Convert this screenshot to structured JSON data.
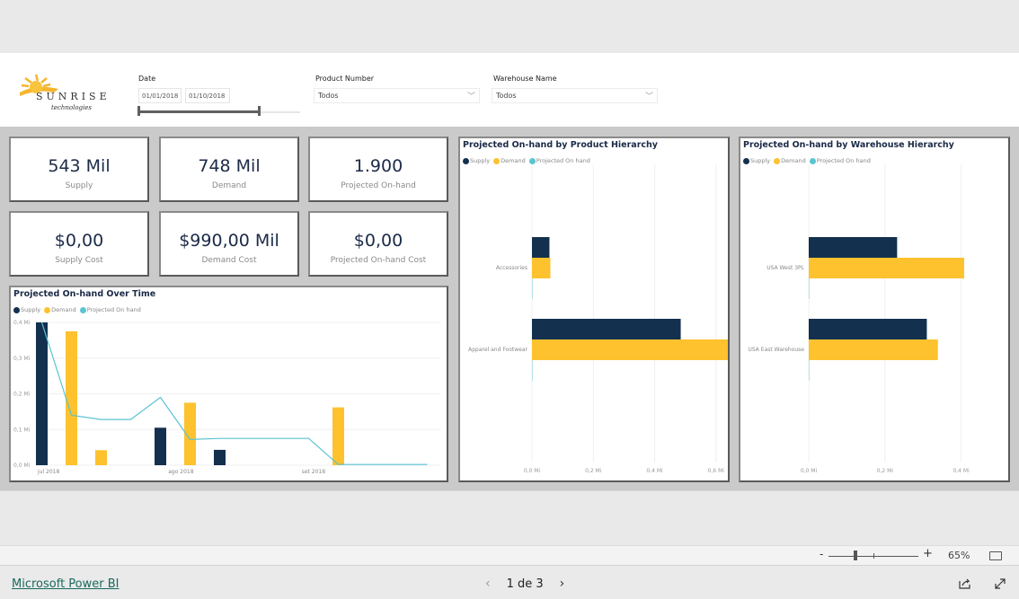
{
  "header": {
    "logo": {
      "brand": "SUNRISE",
      "sub": "technologies"
    },
    "date_slicer": {
      "label": "Date",
      "start": "01/01/2018",
      "end": "01/10/2018",
      "range_fill_fraction": 0.75
    },
    "product_slicer": {
      "label": "Product Number",
      "value": "Todos"
    },
    "warehouse_slicer": {
      "label": "Warehouse Name",
      "value": "Todos"
    }
  },
  "kpis": [
    {
      "value": "543 Mil",
      "label": "Supply"
    },
    {
      "value": "748 Mil",
      "label": "Demand"
    },
    {
      "value": "1.900",
      "label": "Projected On-hand"
    },
    {
      "value": "$0,00",
      "label": "Supply Cost"
    },
    {
      "value": "$990,00 Mil",
      "label": "Demand Cost"
    },
    {
      "value": "$0,00",
      "label": "Projected On-hand Cost"
    }
  ],
  "legend": [
    {
      "name": "Supply",
      "color": "#13304f"
    },
    {
      "name": "Demand",
      "color": "#fdc22d"
    },
    {
      "name": "Projected On hand",
      "color": "#5bc4d3"
    }
  ],
  "chart_data": [
    {
      "type": "bar+line",
      "title": "Projected On-hand Over Time",
      "ylim": [
        0,
        0.4
      ],
      "yticks": [
        "0,0 Mi",
        "0,1 Mi",
        "0,2 Mi",
        "0,3 Mi",
        "0,4 Mi"
      ],
      "ytick_values": [
        0,
        0.1,
        0.2,
        0.3,
        0.4
      ],
      "xticks": [
        {
          "label": "jul 2018",
          "index": 0
        },
        {
          "label": "ago 2018",
          "index": 4.4
        },
        {
          "label": "set 2018",
          "index": 8.9
        }
      ],
      "n_slots": 14,
      "series": [
        {
          "name": "Supply",
          "kind": "bar",
          "points": [
            [
              0,
              0.4
            ],
            [
              4,
              0.105
            ],
            [
              6,
              0.043
            ]
          ]
        },
        {
          "name": "Demand",
          "kind": "bar",
          "points": [
            [
              1,
              0.375
            ],
            [
              2,
              0.042
            ],
            [
              5,
              0.175
            ],
            [
              10,
              0.162
            ]
          ]
        },
        {
          "name": "Projected On hand",
          "kind": "line",
          "points": [
            [
              0,
              0.4
            ],
            [
              1,
              0.14
            ],
            [
              2,
              0.128
            ],
            [
              3,
              0.128
            ],
            [
              4,
              0.19
            ],
            [
              5,
              0.072
            ],
            [
              6,
              0.075
            ],
            [
              7,
              0.075
            ],
            [
              8,
              0.075
            ],
            [
              9,
              0.075
            ],
            [
              10,
              0.002
            ],
            [
              11,
              0.002
            ],
            [
              12,
              0.002
            ],
            [
              13,
              0.002
            ]
          ]
        }
      ],
      "grid": true,
      "legend_position": "top-left"
    },
    {
      "type": "hbar",
      "title": "Projected On-hand by Product Hierarchy",
      "categories": [
        "Accessories",
        "Apparel and Footwear"
      ],
      "series": [
        {
          "name": "Supply",
          "values": [
            0.057,
            0.485
          ]
        },
        {
          "name": "Demand",
          "values": [
            0.06,
            0.69
          ]
        },
        {
          "name": "Projected On hand",
          "values": [
            0.001,
            0.001
          ]
        }
      ],
      "xlim": [
        0,
        0.75
      ],
      "xticks": [
        "0,0 Mi",
        "0,2 Mi",
        "0,4 Mi",
        "0,6 Mi"
      ],
      "xtick_values": [
        0,
        0.2,
        0.4,
        0.6
      ],
      "grid": true,
      "legend_position": "top-left"
    },
    {
      "type": "hbar",
      "title": "Projected On-hand by Warehouse Hierarchy",
      "categories": [
        "USA West 3PL",
        "USA East Warehouse"
      ],
      "series": [
        {
          "name": "Supply",
          "values": [
            0.232,
            0.31
          ]
        },
        {
          "name": "Demand",
          "values": [
            0.408,
            0.339
          ]
        },
        {
          "name": "Projected On hand",
          "values": [
            0.001,
            0.001
          ]
        }
      ],
      "xlim": [
        0,
        0.5
      ],
      "xticks": [
        "0,0 Mi",
        "0,2 Mi",
        "0,4 Mi"
      ],
      "xtick_values": [
        0,
        0.2,
        0.4
      ],
      "grid": true,
      "legend_position": "top-left"
    }
  ],
  "zoom": {
    "minus": "-",
    "plus": "+",
    "level": "65%",
    "slider_fraction": 0.3
  },
  "footer": {
    "link": "Microsoft Power BI",
    "page": "1 de 3",
    "prev": "‹",
    "next": "›"
  }
}
